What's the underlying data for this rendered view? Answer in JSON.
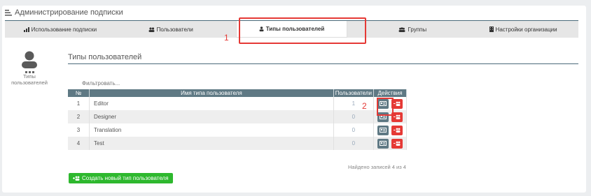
{
  "header": {
    "title": "Администрирование подписки"
  },
  "tabs": [
    {
      "label": "Использование подписки",
      "icon": "chart-icon"
    },
    {
      "label": "Пользователи",
      "icon": "users-icon"
    },
    {
      "label": "Типы пользователей",
      "icon": "user-icon",
      "active": true
    },
    {
      "label": "Группы",
      "icon": "group-icon"
    },
    {
      "label": "Настройки организации",
      "icon": "building-icon"
    }
  ],
  "callouts": {
    "one": "1",
    "two": "2"
  },
  "sidebar": {
    "label": "Типы пользователей"
  },
  "section_title": "Типы пользователей",
  "filter": {
    "placeholder": "Фильтровать..."
  },
  "table": {
    "headers": {
      "num": "№",
      "name": "Имя типа пользователя",
      "users": "Пользователи",
      "actions": "Действия"
    },
    "rows": [
      {
        "num": "1",
        "name": "Editor",
        "users": "1"
      },
      {
        "num": "2",
        "name": "Designer",
        "users": "0"
      },
      {
        "num": "3",
        "name": "Translation",
        "users": "0"
      },
      {
        "num": "4",
        "name": "Test",
        "users": "0"
      }
    ]
  },
  "summary": "Найдено записей 4 из 4",
  "create_button": {
    "label": "Создать новый тип пользователя"
  },
  "colors": {
    "accent": "#5f7984",
    "danger": "#e53935",
    "success": "#2eb82e",
    "callout": "#e53935"
  }
}
